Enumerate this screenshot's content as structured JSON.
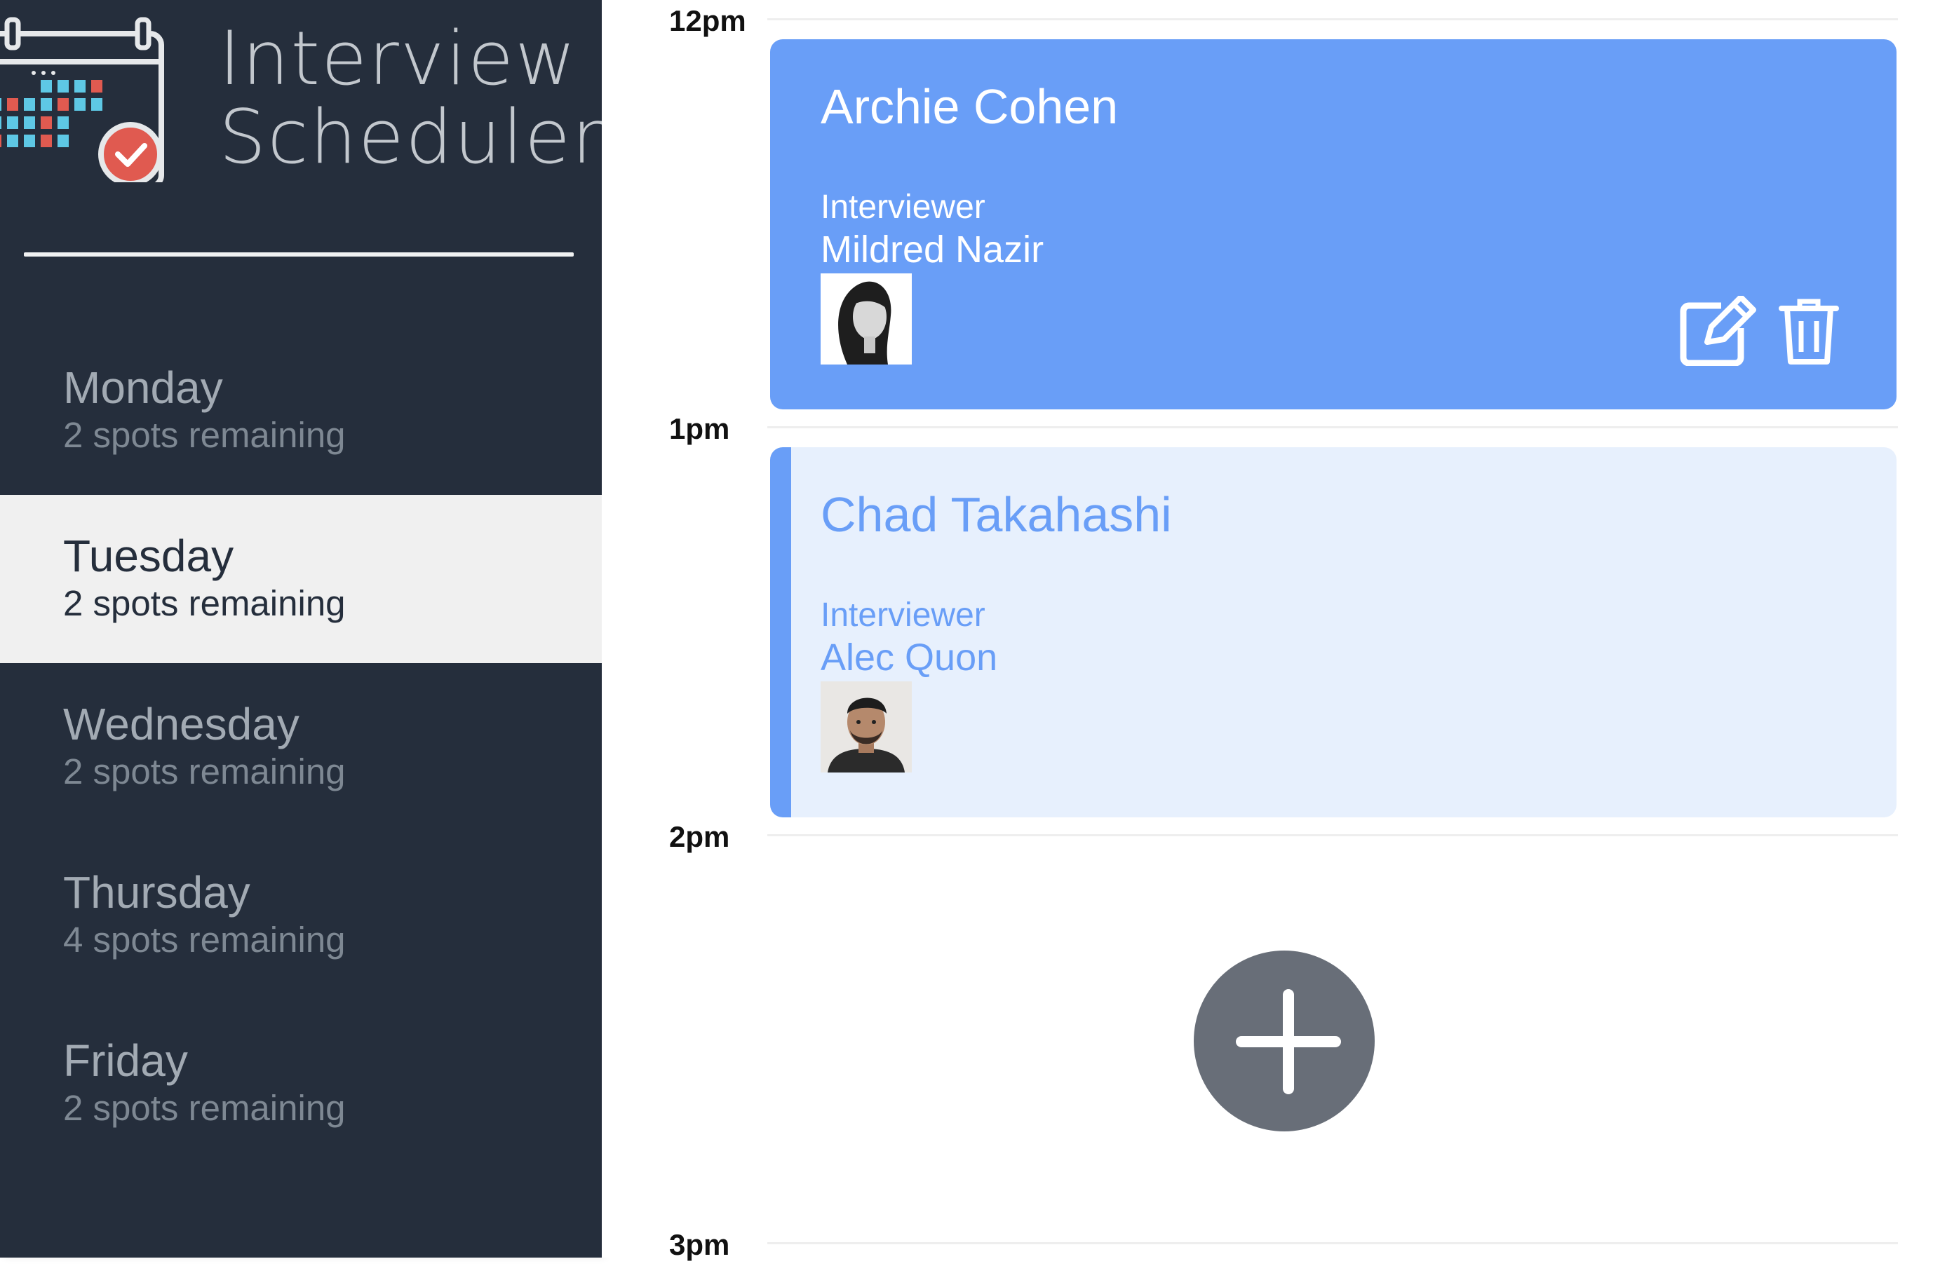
{
  "brand": {
    "title_line1": "Interview",
    "title_line2": "Scheduler",
    "logo_icon": "calendar-check-icon"
  },
  "days": [
    {
      "name": "Monday",
      "spots": "2 spots remaining",
      "selected": false
    },
    {
      "name": "Tuesday",
      "spots": "2 spots remaining",
      "selected": true
    },
    {
      "name": "Wednesday",
      "spots": "2 spots remaining",
      "selected": false
    },
    {
      "name": "Thursday",
      "spots": "4 spots remaining",
      "selected": false
    },
    {
      "name": "Friday",
      "spots": "2 spots remaining",
      "selected": false
    }
  ],
  "times": [
    "12pm",
    "1pm",
    "2pm",
    "3pm"
  ],
  "appointments": [
    {
      "student": "Archie Cohen",
      "interviewer_label": "Interviewer",
      "interviewer": "Mildred Nazir",
      "state": "hover",
      "actions": [
        "edit-icon",
        "trash-icon"
      ]
    },
    {
      "student": "Chad Takahashi",
      "interviewer_label": "Interviewer",
      "interviewer": "Alec Quon",
      "state": "default"
    }
  ],
  "empty_slot": {
    "icon": "plus-icon"
  },
  "colors": {
    "sidebar": "#252e3c",
    "accent": "#699ef7",
    "appointment_light": "#e7f0fd",
    "add_button": "#686e78",
    "selected_day": "#f0f0f0"
  }
}
